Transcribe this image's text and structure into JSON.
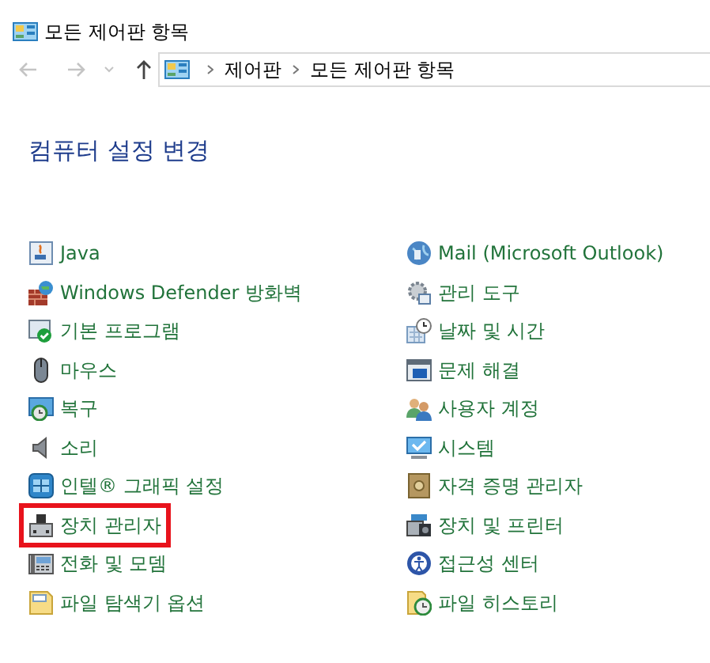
{
  "window": {
    "title": "모든 제어판 항목"
  },
  "address_bar": {
    "crumbs": [
      "제어판",
      "모든 제어판 항목"
    ]
  },
  "heading": "컴퓨터 설정 변경",
  "columns": [
    {
      "items": [
        {
          "label": "Java",
          "highlighted": false
        },
        {
          "label": "Windows Defender 방화벽",
          "highlighted": false
        },
        {
          "label": "기본 프로그램",
          "highlighted": false
        },
        {
          "label": "마우스",
          "highlighted": false
        },
        {
          "label": "복구",
          "highlighted": false
        },
        {
          "label": "소리",
          "highlighted": false
        },
        {
          "label": "인텔® 그래픽 설정",
          "highlighted": false
        },
        {
          "label": "장치 관리자",
          "highlighted": true
        },
        {
          "label": "전화 및 모뎀",
          "highlighted": false
        },
        {
          "label": "파일 탐색기 옵션",
          "highlighted": false
        }
      ]
    },
    {
      "items": [
        {
          "label": "Mail (Microsoft Outlook)",
          "highlighted": false
        },
        {
          "label": "관리 도구",
          "highlighted": false
        },
        {
          "label": "날짜 및 시간",
          "highlighted": false
        },
        {
          "label": "문제 해결",
          "highlighted": false
        },
        {
          "label": "사용자 계정",
          "highlighted": false
        },
        {
          "label": "시스템",
          "highlighted": false
        },
        {
          "label": "자격 증명 관리자",
          "highlighted": false
        },
        {
          "label": "장치 및 프린터",
          "highlighted": false
        },
        {
          "label": "접근성 센터",
          "highlighted": false
        },
        {
          "label": "파일 히스토리",
          "highlighted": false
        }
      ]
    }
  ]
}
